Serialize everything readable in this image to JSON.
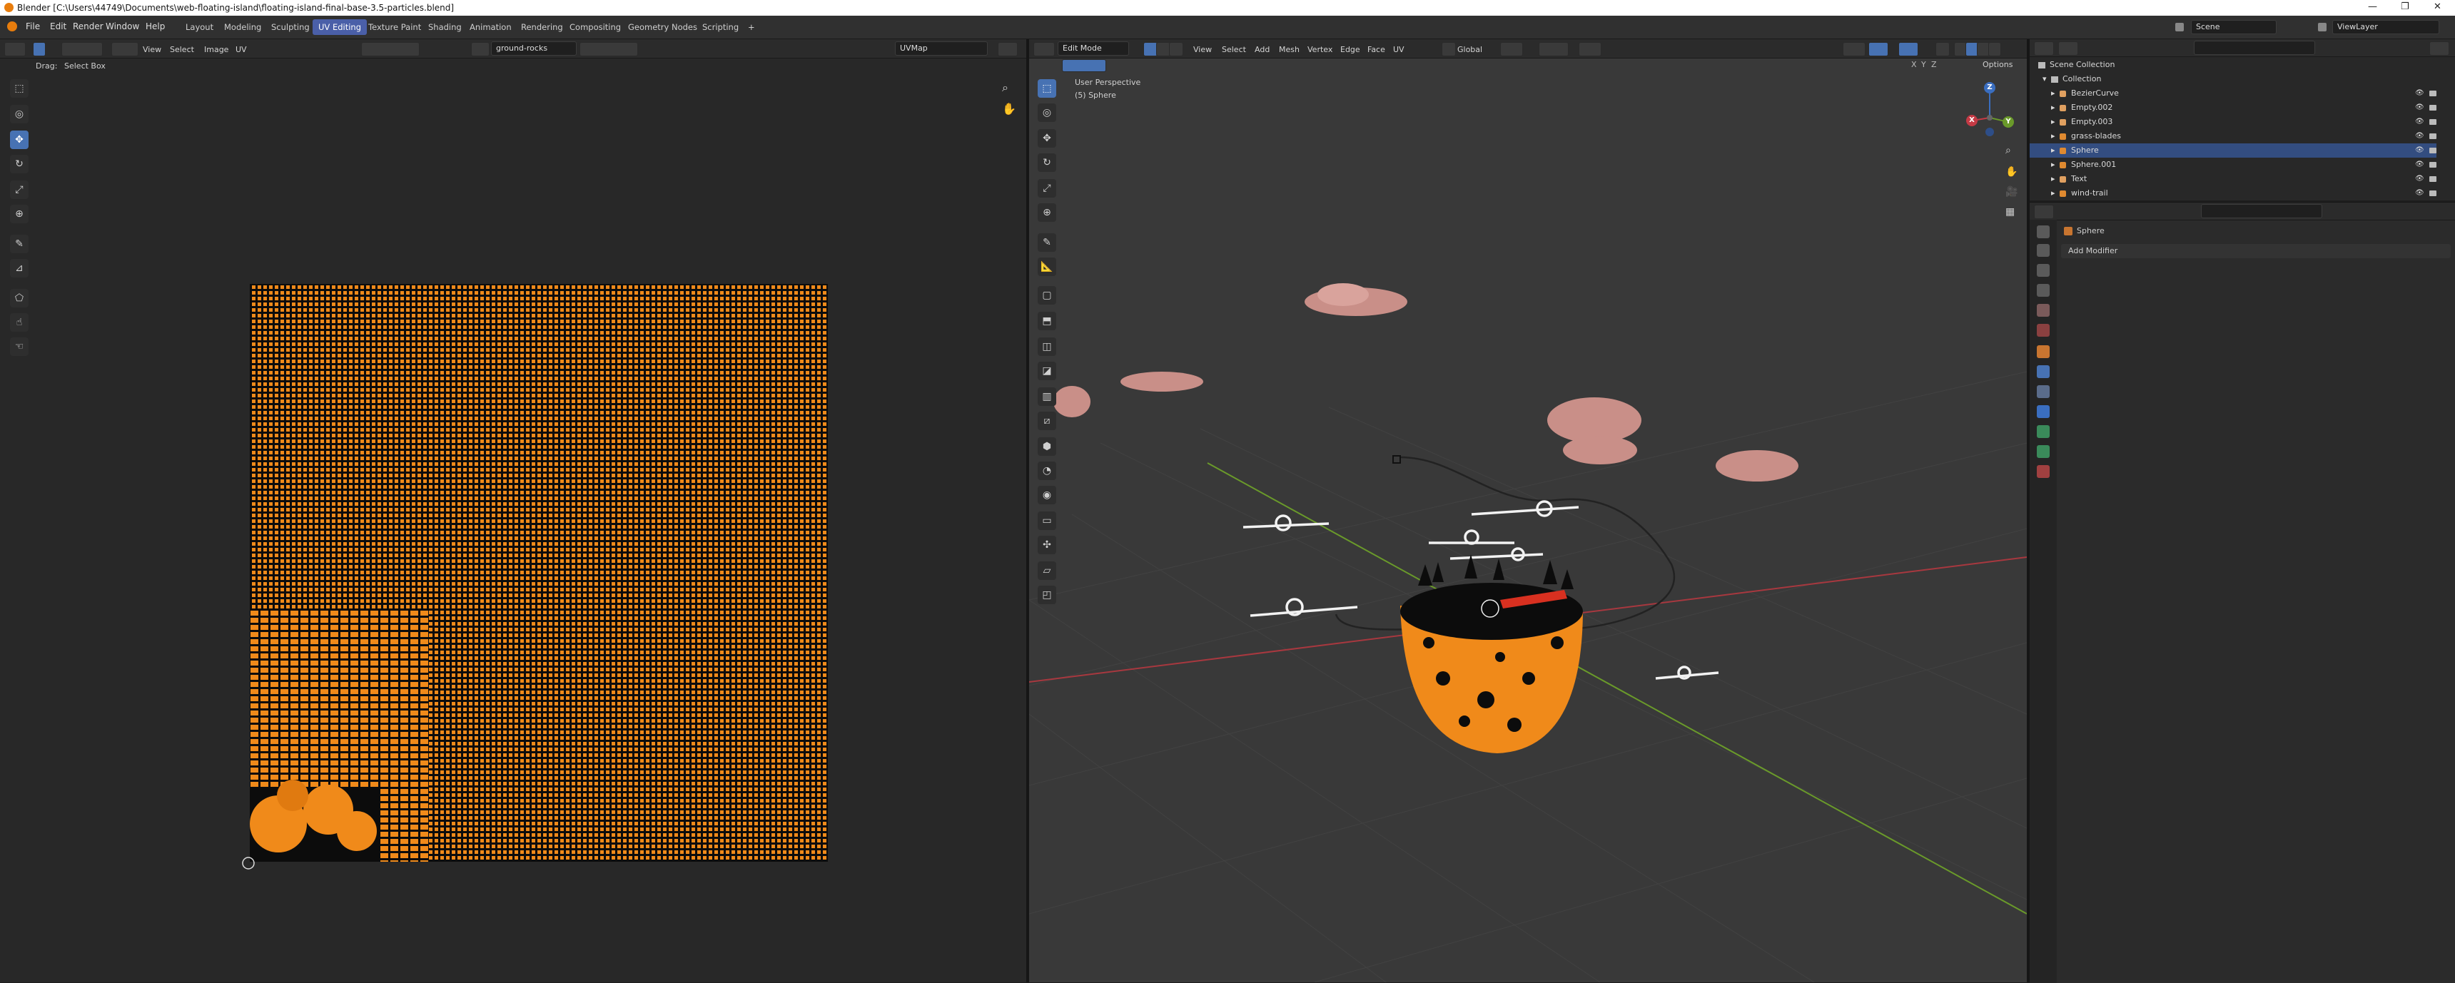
{
  "window": {
    "title": "Blender [C:\\Users\\44749\\Documents\\web-floating-island\\floating-island-final-base-3.5-particles.blend]",
    "minimize": "—",
    "maximize": "❐",
    "close": "✕"
  },
  "menu": [
    "File",
    "Edit",
    "Render",
    "Window",
    "Help"
  ],
  "workspaces": [
    "Layout",
    "Modeling",
    "Sculpting",
    "UV Editing",
    "Texture Paint",
    "Shading",
    "Animation",
    "Rendering",
    "Compositing",
    "Geometry Nodes",
    "Scripting",
    "+"
  ],
  "active_workspace": "UV Editing",
  "scene": {
    "label": "Scene",
    "view_layer": "ViewLayer"
  },
  "uv_editor": {
    "menus": [
      "View",
      "Select",
      "Image",
      "UV"
    ],
    "image_name": "ground-rocks",
    "uv_map": "UVMap",
    "drag_label": "Drag:",
    "drag_value": "Select Box",
    "tools": [
      "select",
      "cursor",
      "move",
      "rotate",
      "scale",
      "transform",
      "annotate",
      "rip",
      "grab",
      "relax",
      "pinch"
    ]
  },
  "viewport": {
    "mode": "Edit Mode",
    "menus": [
      "View",
      "Select",
      "Add",
      "Mesh",
      "Vertex",
      "Edge",
      "Face",
      "UV"
    ],
    "orientation": "Global",
    "options": "Options",
    "axes": [
      "X",
      "Y",
      "Z"
    ],
    "perspective": "User Perspective",
    "object_info": "(5) Sphere",
    "gizmo_axes": {
      "x": "X",
      "y": "Y",
      "z": "Z"
    }
  },
  "outliner": {
    "root": "Scene Collection",
    "collection": "Collection",
    "items": [
      {
        "name": "BezierCurve",
        "color": "#e0a060"
      },
      {
        "name": "Empty.002",
        "color": "#e0a060"
      },
      {
        "name": "Empty.003",
        "color": "#e0a060"
      },
      {
        "name": "grass-blades",
        "color": "#e08a30"
      },
      {
        "name": "Sphere",
        "color": "#e08a30",
        "selected": true
      },
      {
        "name": "Sphere.001",
        "color": "#e08a30"
      },
      {
        "name": "Text",
        "color": "#e0a060"
      },
      {
        "name": "wind-trail",
        "color": "#e08a30"
      }
    ]
  },
  "properties": {
    "object": "Sphere",
    "add_modifier": "Add Modifier"
  },
  "colors": {
    "accent": "#4772b3",
    "uv_orange": "#f08a1a",
    "cloud": "#c98f88",
    "axis_x": "#a8383f",
    "axis_y": "#6a9a2a"
  }
}
